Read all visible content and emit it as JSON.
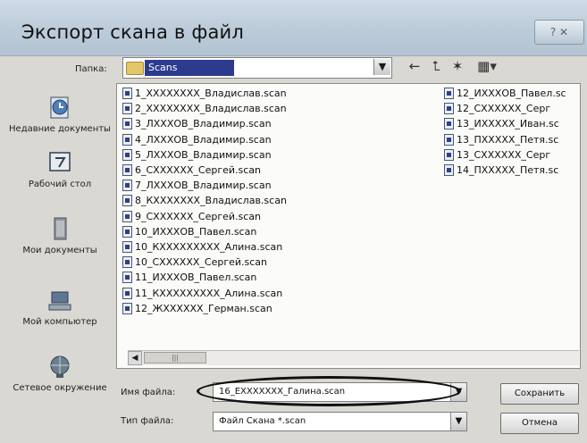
{
  "dialog": {
    "title": "Экспорт скана в файл",
    "help_label": "? ✕"
  },
  "location": {
    "label": "Папка:",
    "value": "Scans",
    "dropdown_glyph": "▼"
  },
  "toolbar": {
    "back": "←",
    "up": "⮤",
    "new_folder": "✶",
    "view": "▦▾"
  },
  "places": [
    {
      "label": "Недавние документы",
      "icon": "recent-documents-icon"
    },
    {
      "label": "Рабочий стол",
      "icon": "desktop-icon"
    },
    {
      "label": "Мои документы",
      "icon": "my-documents-icon"
    },
    {
      "label": "Мой компьютер",
      "icon": "my-computer-icon"
    },
    {
      "label": "Сетевое окружение",
      "icon": "network-icon"
    }
  ],
  "files": {
    "column1": [
      "1_ХХХХХХХХ_Владислав.scan",
      "2_ХХХХХХХХ_Владислав.scan",
      "3_ЛХХХОВ_Владимир.scan",
      "4_ЛХХХОВ_Владимир.scan",
      "5_ЛХХХОВ_Владимир.scan",
      "6_СХХХХХХ_Сергей.scan",
      "7_ЛХХХОВ_Владимир.scan",
      "8_КХХХХХХХ_Владислав.scan",
      "9_СХХХХХХ_Сергей.scan",
      "10_ИХХХОВ_Павел.scan",
      "10_КХХХХХХХХХ_Алина.scan",
      "10_СХХХХХХ_Сергей.scan",
      "11_ИХХХОВ_Павел.scan",
      "11_КХХХХХХХХХ_Алина.scan",
      "12_ЖХХХХХХ_Герман.scan"
    ],
    "column2": [
      "12_ИХХХОВ_Павел.sc",
      "12_СХХХХХХ_Серг",
      "13_ИХХХХХ_Иван.sc",
      "13_ПХХХХХ_Петя.sc",
      "13_СХХХХХХ_Серг",
      "14_ПХХХХХ_Петя.sc"
    ]
  },
  "scrollbar": {
    "left_arrow": "◀",
    "thumb_grip": "|||"
  },
  "filename": {
    "label": "Имя файла:",
    "value": "16_ЕХХХХХХХ_Галина.scan"
  },
  "filetype": {
    "label": "Тип файла:",
    "value": "Файл Скана *.scan"
  },
  "buttons": {
    "save": "Сохранить",
    "cancel": "Отмена"
  }
}
